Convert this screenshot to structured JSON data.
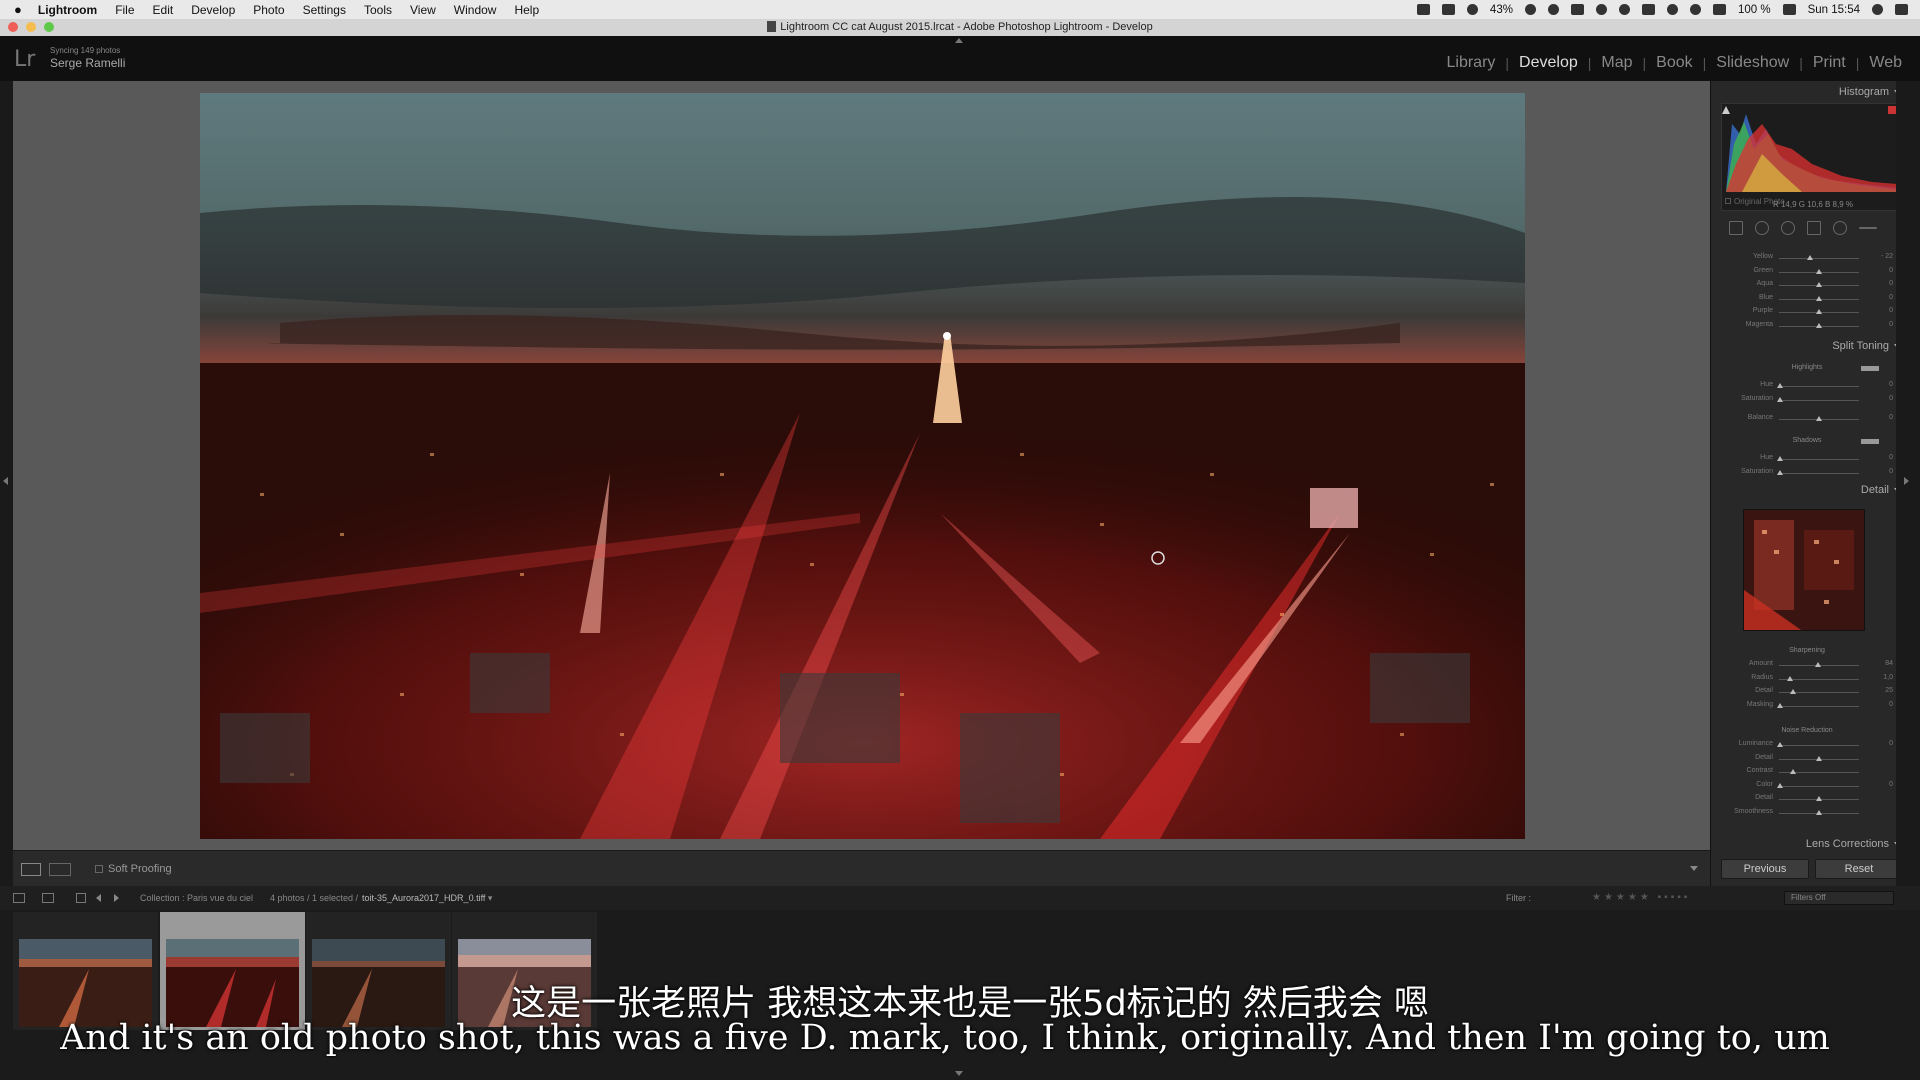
{
  "menubar": {
    "apple": "",
    "items": [
      "Lightroom",
      "File",
      "Edit",
      "Develop",
      "Photo",
      "Settings",
      "Tools",
      "View",
      "Window",
      "Help"
    ],
    "battery": "43%",
    "battery2": "100 %",
    "clock": "Sun 15:54"
  },
  "window": {
    "title": "Lightroom CC cat August 2015.lrcat - Adobe Photoshop Lightroom - Develop"
  },
  "identity": {
    "logo": "Lr",
    "sync": "Syncing 149 photos",
    "name": "Serge Ramelli"
  },
  "modules": [
    "Library",
    "Develop",
    "Map",
    "Book",
    "Slideshow",
    "Print",
    "Web"
  ],
  "toolbar": {
    "soft_proofing": "Soft Proofing"
  },
  "right_panel": {
    "histogram": "Histogram",
    "histo_vals": "R 14,9 G 10,6 B 8,9 %",
    "original_photo": "Original Photo",
    "hsl_rows": [
      {
        "label": "Yellow",
        "value": "- 22"
      },
      {
        "label": "Green",
        "value": "0"
      },
      {
        "label": "Aqua",
        "value": "0"
      },
      {
        "label": "Blue",
        "value": "0"
      },
      {
        "label": "Purple",
        "value": "0"
      },
      {
        "label": "Magenta",
        "value": "0"
      }
    ],
    "split_toning": "Split Toning",
    "highlights": "Highlights",
    "shadows": "Shadows",
    "split_rows_hi": [
      {
        "label": "Hue",
        "value": "0"
      },
      {
        "label": "Saturation",
        "value": "0"
      }
    ],
    "balance": {
      "label": "Balance",
      "value": "0"
    },
    "split_rows_sh": [
      {
        "label": "Hue",
        "value": "0"
      },
      {
        "label": "Saturation",
        "value": "0"
      }
    ],
    "detail": "Detail",
    "sharpening": "Sharpening",
    "sharp_rows": [
      {
        "label": "Amount",
        "value": "84"
      },
      {
        "label": "Radius",
        "value": "1,0"
      },
      {
        "label": "Detail",
        "value": "25"
      },
      {
        "label": "Masking",
        "value": "0"
      }
    ],
    "noise_reduction": "Noise Reduction",
    "noise_rows": [
      {
        "label": "Luminance",
        "value": "0"
      },
      {
        "label": "Detail",
        "value": ""
      },
      {
        "label": "Contrast",
        "value": ""
      },
      {
        "label": "Color",
        "value": "0"
      },
      {
        "label": "Detail",
        "value": ""
      },
      {
        "label": "Smoothness",
        "value": ""
      }
    ],
    "lens_corrections": "Lens Corrections",
    "previous": "Previous",
    "reset": "Reset"
  },
  "filmstrip_bar": {
    "collection": "Collection : Paris vue du ciel",
    "count": "4 photos / 1 selected /",
    "filename": "toit-35_Aurora2017_HDR_0.tiff",
    "filter": "Filter :",
    "filters_off": "Filters Off"
  },
  "subtitles": {
    "cn": "这是一张老照片 我想这本来也是一张5d标记的 然后我会 嗯",
    "en": "And it's an old photo shot, this was a five D. mark, too, I think, originally. And then I'm going to, um"
  },
  "colors": {
    "accent_active": "#dddddd",
    "panel_bg": "#282828",
    "canvas_bg": "#595959",
    "city_glow": "#ff2a3a"
  }
}
